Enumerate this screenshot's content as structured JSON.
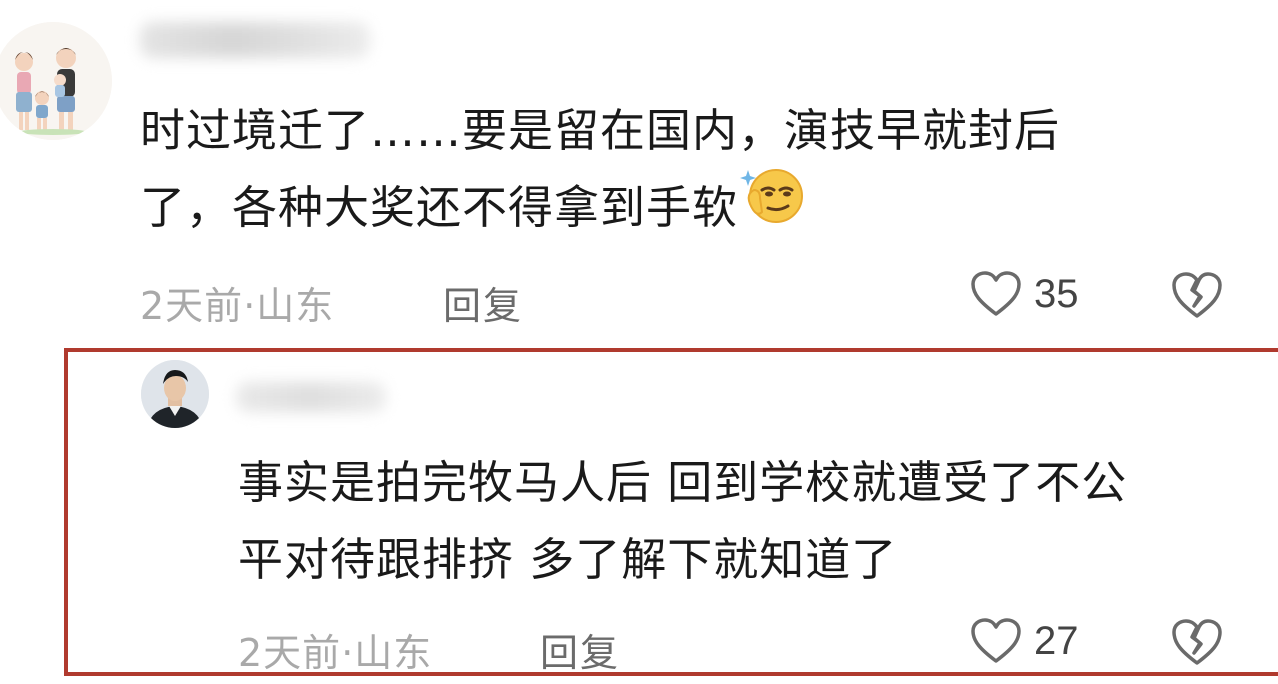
{
  "comments": [
    {
      "text_lines": [
        "时过境迁了……要是留在国内，演技早就封后",
        "了，各种大奖还不得拿到手软"
      ],
      "time": "2天前",
      "separator": "·",
      "location": "山东",
      "reply_label": "回复",
      "like_count": "35",
      "emoji_icon": "smirk-emoji-icon",
      "avatar_icon": "family-illustration-avatar"
    },
    {
      "text_lines": [
        "事实是拍完牧马人后 回到学校就遭受了不公",
        "平对待跟排挤 多了解下就知道了"
      ],
      "time": "2天前",
      "separator": "·",
      "location": "山东",
      "reply_label": "回复",
      "like_count": "27",
      "avatar_icon": "man-in-suit-photo-avatar"
    }
  ],
  "colors": {
    "highlight_border": "#b03a2e",
    "text_primary": "#1a1a1a",
    "text_meta": "#a9a9a9",
    "reply": "#6b6b6b"
  },
  "icons": {
    "like": "heart-outline-icon",
    "dislike": "broken-heart-icon"
  }
}
